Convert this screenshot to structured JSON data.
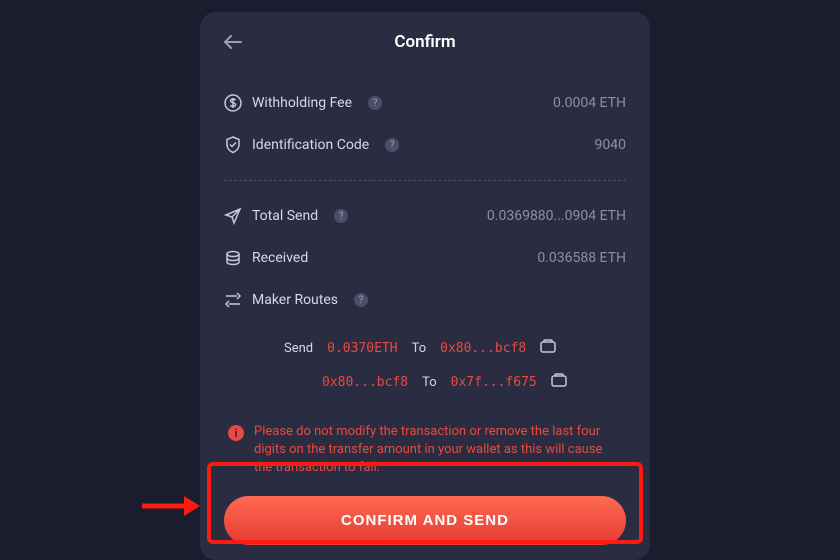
{
  "header": {
    "title": "Confirm"
  },
  "fields": {
    "withholding_fee": {
      "label": "Withholding Fee",
      "value": "0.0004 ETH"
    },
    "identification_code": {
      "label": "Identification Code",
      "value": "9040"
    },
    "total_send": {
      "label": "Total Send",
      "value": "0.0369880...0904 ETH"
    },
    "received": {
      "label": "Received",
      "value": "0.036588 ETH"
    },
    "maker_routes": {
      "label": "Maker Routes"
    }
  },
  "routes": [
    {
      "send_label": "Send",
      "amount": "0.0370ETH",
      "to_label": "To",
      "address": "0x80...bcf8"
    },
    {
      "send_label": "",
      "amount": "0x80...bcf8",
      "to_label": "To",
      "address": "0x7f...f675"
    }
  ],
  "warning": {
    "text": "Please do not modify the transaction or remove the last four digits on the transfer amount in your wallet as this will cause the transaction to fail."
  },
  "confirm_button": {
    "label": "CONFIRM AND SEND"
  }
}
